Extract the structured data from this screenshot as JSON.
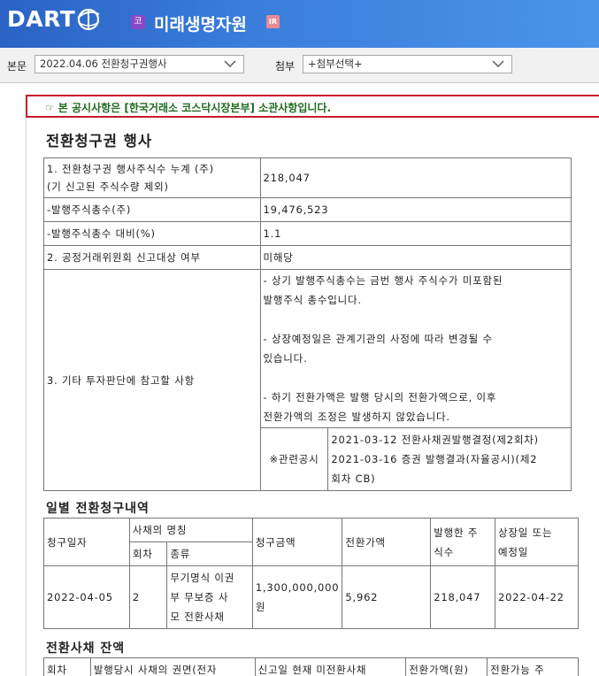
{
  "header": {
    "logo_text": "DART",
    "corp_badge": "코",
    "corp_name": "미래생명자원",
    "ir_badge": "IR"
  },
  "selector": {
    "main_label": "본문",
    "main_value": "2022.04.06  전환청구권행사",
    "attach_label": "첨부",
    "attach_value": "+첨부선택+"
  },
  "notice": "본 공시사항은 [한국거래소 코스닥시장본부] 소관사항입니다.",
  "doc_title": "전환청구권 행사",
  "summary": {
    "r1_label_a": "1. 전환청구권 행사주식수 누계 (주)",
    "r1_label_b": "(기 신고된 주식수량 제외)",
    "r1_value": "218,047",
    "r2_label": "-발행주식총수(주)",
    "r2_value": "19,476,523",
    "r3_label": "-발행주식총수 대비(%)",
    "r3_value": "1.1",
    "r4_label": "2. 공정거래위원회 신고대상 여부",
    "r4_value": "미해당",
    "r5_label": "3. 기타 투자판단에 참고할 사항",
    "r5_lines": [
      "- 상기 발행주식총수는 금번 행사 주식수가 미포함된",
      "발행주식 총수입니다.",
      "- 상장예정일은 관계기관의 사정에 따라 변경될 수",
      "있습니다.",
      "- 하기 전환가액은 발행 당시의 전환가액으로, 이후",
      "전환가액의 조정은 발생하지 않았습니다."
    ],
    "related_label": "※관련공시",
    "related_1": "2021-03-12 전환사채권발행결정(제2회차)",
    "related_2a": "2021-03-16 증권 발행결과(자율공시)(제2",
    "related_2b": "회차 CB)"
  },
  "daily": {
    "title": "일별 전환청구내역",
    "h_date": "청구일자",
    "h_bond_name": "사채의 명칭",
    "h_series": "회차",
    "h_kind": "종류",
    "h_amount": "청구금액",
    "h_price": "전환가액",
    "h_issued_a": "발행한 주",
    "h_issued_b": "식수",
    "h_listing_a": "상장일 또는",
    "h_listing_b": "예정일",
    "row": {
      "date": "2022-04-05",
      "series": "2",
      "kind_1": "무기명식 이권",
      "kind_2": "부 무보증 사",
      "kind_3": "모 전환사채",
      "amount_1": "1,300,000,000",
      "amount_2": "원",
      "price": "5,962",
      "issued": "218,047",
      "listing": "2022-04-22"
    }
  },
  "balance": {
    "title": "전환사채 잔액",
    "h_series": "회차",
    "h_face": "발행당시 사채의 권면(전자",
    "h_unconverted": "신고일 현재 미전환사채",
    "h_price": "전환가액(원)",
    "h_possible": "전환가능 주"
  }
}
